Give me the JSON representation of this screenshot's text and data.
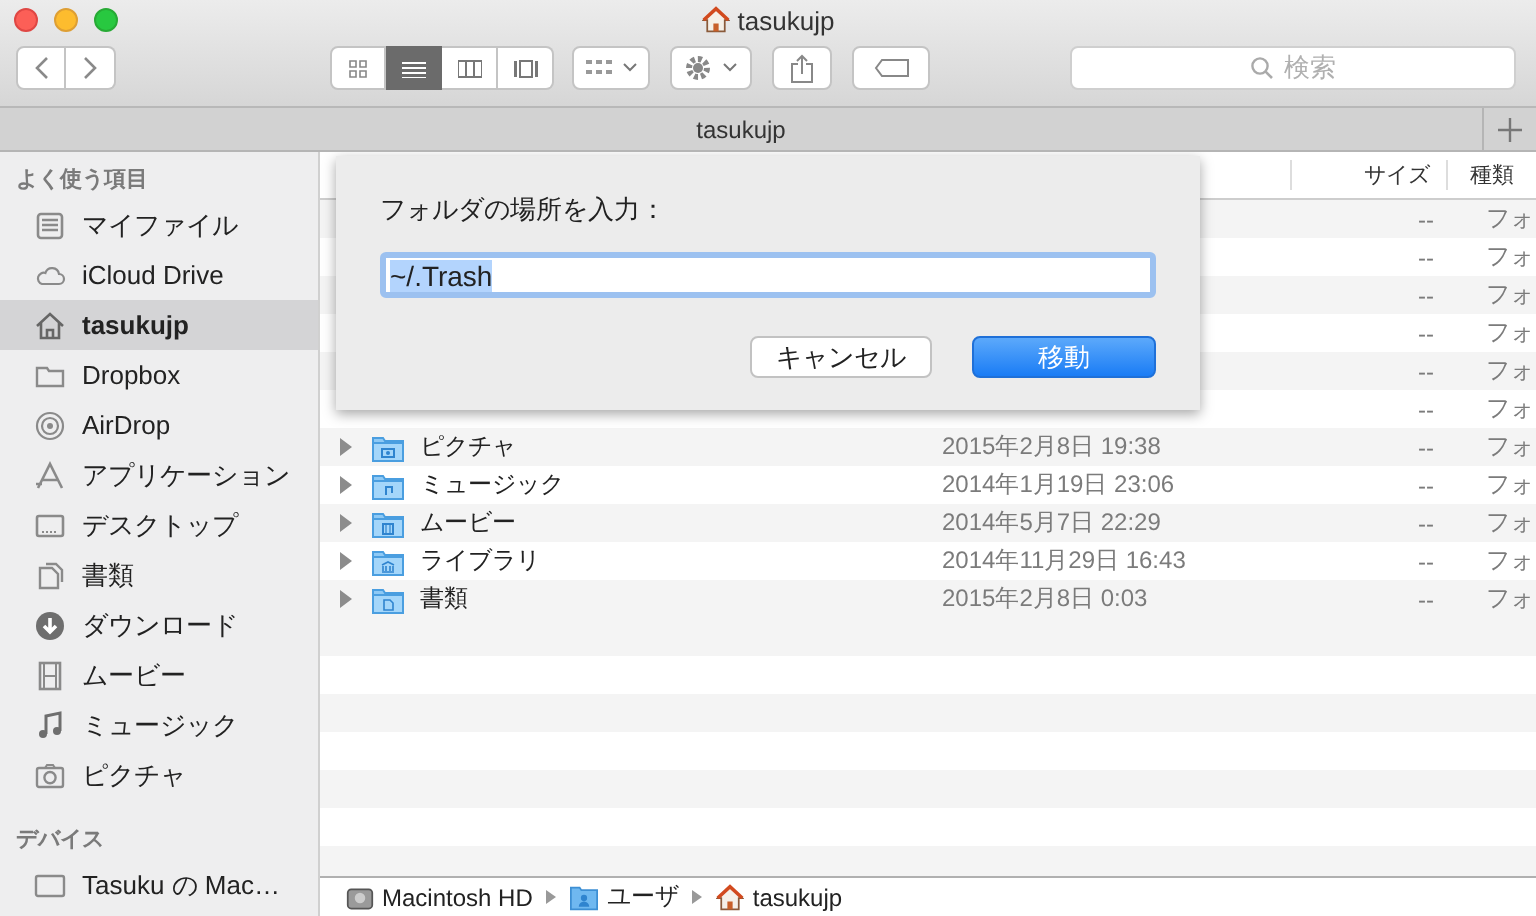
{
  "window": {
    "title": "tasukujp"
  },
  "toolbar": {
    "view_modes": [
      {
        "selected": false
      },
      {
        "selected": true
      },
      {
        "selected": false
      },
      {
        "selected": false
      }
    ],
    "search": {
      "placeholder": "検索"
    }
  },
  "tab_bar": {
    "tabs": [
      {
        "label": "tasukujp"
      }
    ]
  },
  "sidebar": {
    "sections": [
      {
        "title": "よく使う項目",
        "items": [
          {
            "label": "マイファイル",
            "selected": false
          },
          {
            "label": "iCloud Drive",
            "selected": false
          },
          {
            "label": "tasukujp",
            "selected": true
          },
          {
            "label": "Dropbox",
            "selected": false
          },
          {
            "label": "AirDrop",
            "selected": false
          },
          {
            "label": "アプリケーション",
            "selected": false
          },
          {
            "label": "デスクトップ",
            "selected": false
          },
          {
            "label": "書類",
            "selected": false
          },
          {
            "label": "ダウンロード",
            "selected": false
          },
          {
            "label": "ムービー",
            "selected": false
          },
          {
            "label": "ミュージック",
            "selected": false
          },
          {
            "label": "ピクチャ",
            "selected": false
          }
        ]
      },
      {
        "title": "デバイス",
        "items": [
          {
            "label": "Tasuku の Mac…",
            "selected": false
          }
        ]
      }
    ]
  },
  "file_list": {
    "columns": [
      "サイズ",
      "種類"
    ],
    "rows": [
      {
        "size": "--",
        "kind": "フォ"
      },
      {
        "size": "--",
        "kind": "フォ"
      },
      {
        "size": "--",
        "kind": "フォ"
      },
      {
        "size": "--",
        "kind": "フォ"
      },
      {
        "size": "--",
        "kind": "フォ"
      },
      {
        "size": "--",
        "kind": "フォ"
      },
      {
        "name": "ピクチャ",
        "date": "2015年2月8日 19:38",
        "size": "--",
        "kind": "フォ"
      },
      {
        "name": "ミュージック",
        "date": "2014年1月19日 23:06",
        "size": "--",
        "kind": "フォ"
      },
      {
        "name": "ムービー",
        "date": "2014年5月7日 22:29",
        "size": "--",
        "kind": "フォ"
      },
      {
        "name": "ライブラリ",
        "date": "2014年11月29日 16:43",
        "size": "--",
        "kind": "フォ"
      },
      {
        "name": "書類",
        "date": "2015年2月8日 0:03",
        "size": "--",
        "kind": "フォ"
      }
    ]
  },
  "dialog": {
    "label": "フォルダの場所を入力：",
    "value": "~/.Trash",
    "value_selected": true,
    "buttons": [
      {
        "label": "キャンセル",
        "default": false
      },
      {
        "label": "移動",
        "default": true
      }
    ]
  },
  "path_bar": {
    "items": [
      "Macintosh HD",
      "ユーザ",
      "tasukujp"
    ]
  }
}
